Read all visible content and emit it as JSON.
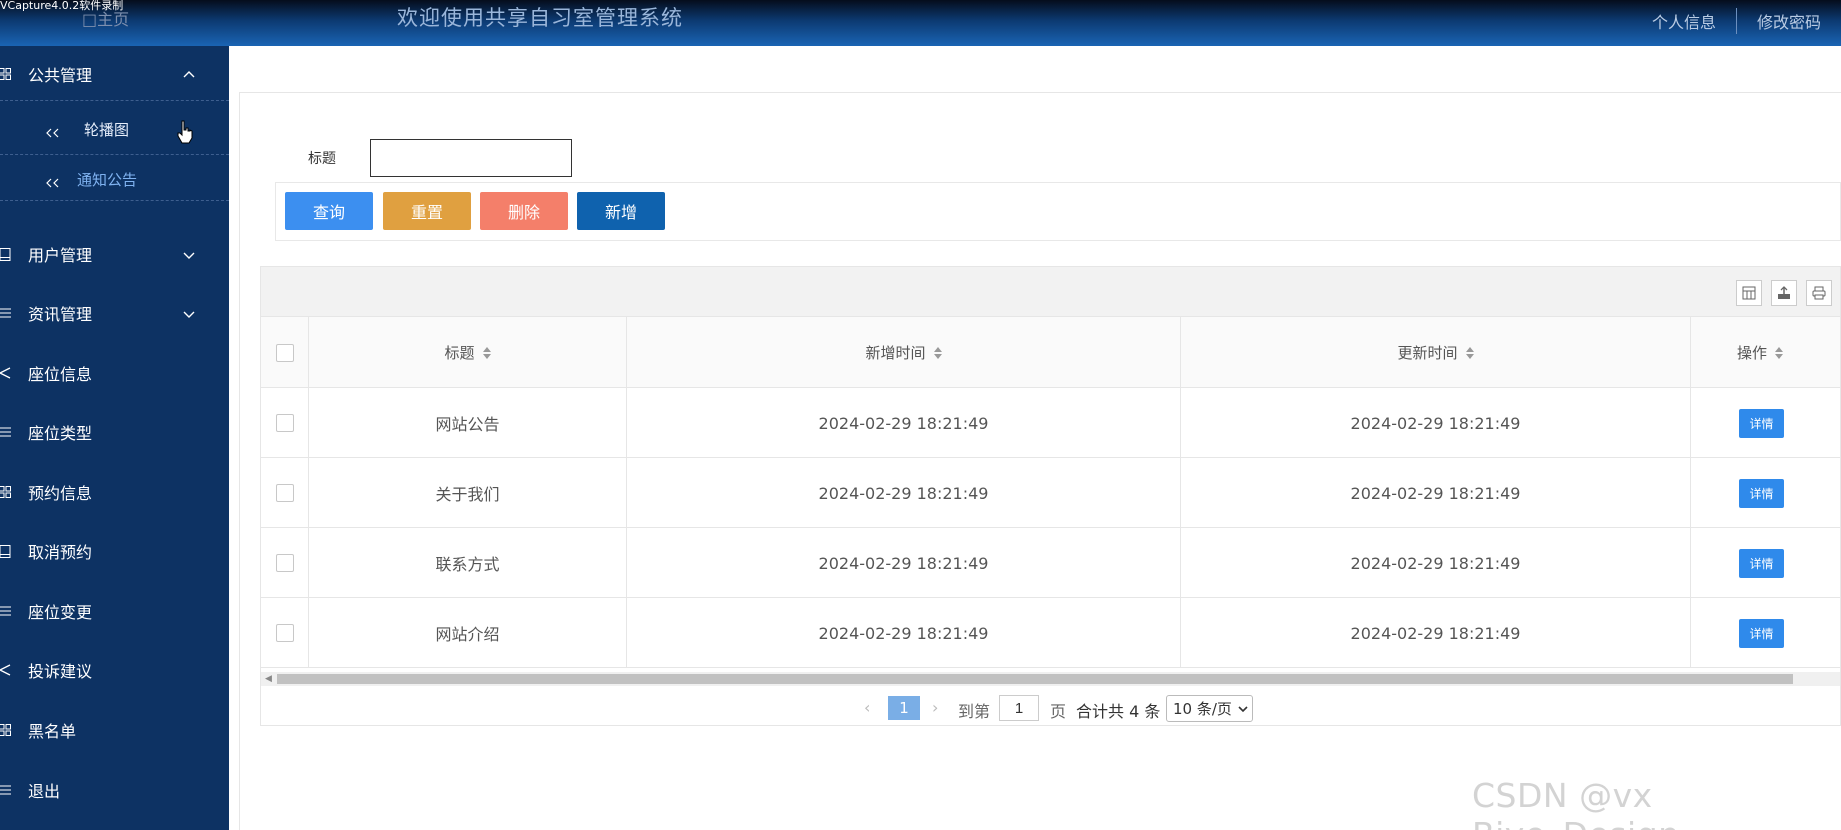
{
  "recorder_label": "VCapture4.0.2软件录制",
  "header": {
    "home": "□主页",
    "welcome": "欢迎使用共享自习室管理系统",
    "links": [
      "个人信息",
      "修改密码"
    ]
  },
  "sidebar": {
    "items": [
      {
        "label": "公共管理",
        "icon": "grid-icon",
        "expanded": true
      },
      {
        "label": "用户管理",
        "icon": "book-icon",
        "expanded": false
      },
      {
        "label": "资讯管理",
        "icon": "list-icon",
        "expanded": false
      },
      {
        "label": "座位信息",
        "icon": "share-icon"
      },
      {
        "label": "座位类型",
        "icon": "list-icon"
      },
      {
        "label": "预约信息",
        "icon": "grid-icon"
      },
      {
        "label": "取消预约",
        "icon": "book-icon"
      },
      {
        "label": "座位变更",
        "icon": "list-icon"
      },
      {
        "label": "投诉建议",
        "icon": "share-icon"
      },
      {
        "label": "黑名单",
        "icon": "grid-icon"
      },
      {
        "label": "退出",
        "icon": "list-icon"
      }
    ],
    "subitems": [
      {
        "label": "轮播图",
        "active": false
      },
      {
        "label": "通知公告",
        "active": true
      }
    ]
  },
  "search": {
    "label": "标题",
    "value": ""
  },
  "buttons": {
    "query": "查询",
    "reset": "重置",
    "delete": "删除",
    "add": "新增"
  },
  "colors": {
    "query": "#3c8ff0",
    "reset": "#e0a040",
    "delete": "#f47f6a",
    "add": "#0f62ae",
    "sidebar": "#0d3263",
    "detail": "#2f8aeb"
  },
  "table": {
    "columns": [
      "标题",
      "新增时间",
      "更新时间",
      "操作"
    ],
    "rows": [
      {
        "title": "网站公告",
        "created": "2024-02-29 18:21:49",
        "updated": "2024-02-29 18:21:49",
        "action": "详情"
      },
      {
        "title": "关于我们",
        "created": "2024-02-29 18:21:49",
        "updated": "2024-02-29 18:21:49",
        "action": "详情"
      },
      {
        "title": "联系方式",
        "created": "2024-02-29 18:21:49",
        "updated": "2024-02-29 18:21:49",
        "action": "详情"
      },
      {
        "title": "网站介绍",
        "created": "2024-02-29 18:21:49",
        "updated": "2024-02-29 18:21:49",
        "action": "详情"
      }
    ]
  },
  "pagination": {
    "current": "1",
    "goto_label": "到第",
    "page_input": "1",
    "page_unit": "页",
    "total": "合计共 4 条",
    "page_size": "10 条/页"
  },
  "watermark": "CSDN @vx Biye_Design"
}
